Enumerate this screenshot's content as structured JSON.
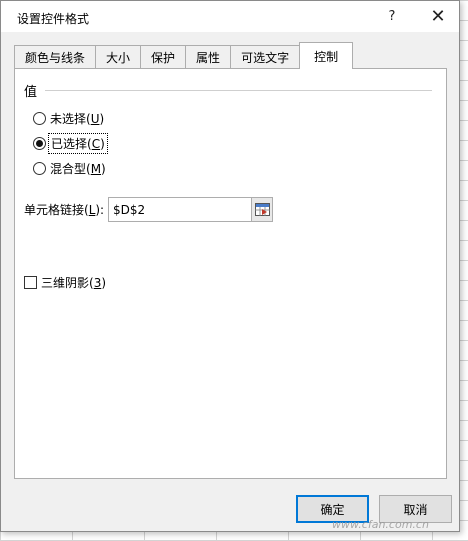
{
  "dialog": {
    "title": "设置控件格式",
    "help_label": "?",
    "close_label": "✕"
  },
  "tabs": [
    {
      "label": "颜色与线条",
      "active": false
    },
    {
      "label": "大小",
      "active": false
    },
    {
      "label": "保护",
      "active": false
    },
    {
      "label": "属性",
      "active": false
    },
    {
      "label": "可选文字",
      "active": false
    },
    {
      "label": "控制",
      "active": true
    }
  ],
  "value_group": {
    "label": "值",
    "options": [
      {
        "text": "未选择(",
        "key": "U",
        "suffix": ")",
        "checked": false
      },
      {
        "text": "已选择(",
        "key": "C",
        "suffix": ")",
        "checked": true
      },
      {
        "text": "混合型(",
        "key": "M",
        "suffix": ")",
        "checked": false
      }
    ]
  },
  "cell_link": {
    "label_prefix": "单元格链接(",
    "label_key": "L",
    "label_suffix": "):",
    "value": "$D$2"
  },
  "shading": {
    "label_prefix": "三维阴影(",
    "label_key": "3",
    "label_suffix": ")",
    "checked": false
  },
  "buttons": {
    "ok": "确定",
    "cancel": "取消"
  },
  "watermark": "www.cfan.com.cn",
  "icons": {
    "collapse": "range-select-icon",
    "close": "close-icon",
    "help": "help-icon"
  }
}
